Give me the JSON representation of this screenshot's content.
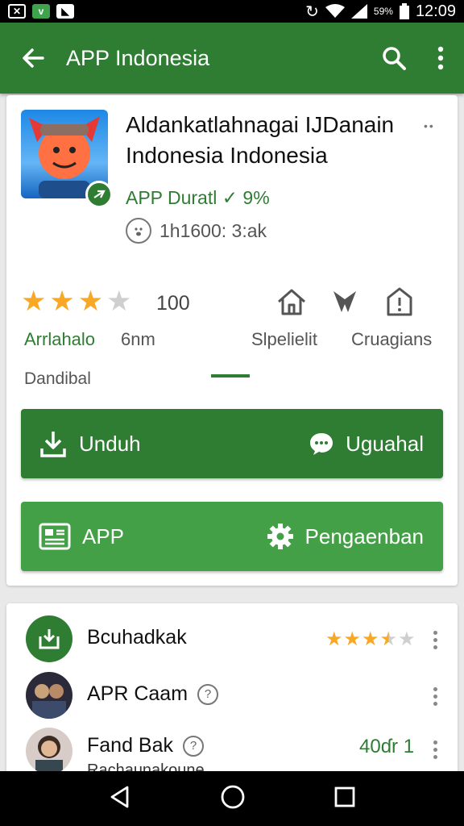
{
  "status_bar": {
    "icons": [
      "x-box-icon",
      "messaging-icon",
      "notification-icon"
    ],
    "battery_text": "59%",
    "time": "12:09"
  },
  "app_bar": {
    "title": "APP Indonesia"
  },
  "app": {
    "name": "Aldankatlahnagai IJDanain Indonesia Indonesia",
    "developer": "APP Duratl ✓ 9%",
    "size_text": "1h1600: 3:ak",
    "rating_count": "100",
    "rating_stars": 3,
    "rating_label": "Arrlahalo",
    "size_label": "6nm",
    "stat1_label": "Slpelielit",
    "stat2_label": "Cruagians",
    "download_label": "Dandibal"
  },
  "buttons": {
    "install_label": "Unduh",
    "chat_label": "Uguahal",
    "app_label": "APP",
    "settings_label": "Pengaenban"
  },
  "list": [
    {
      "name": "Bcuhadkak",
      "stars": 3.5
    },
    {
      "name": "APR Caam"
    },
    {
      "name": "Fand Bak",
      "value": "40ɗr 1",
      "sub": "Rachaunakoune"
    }
  ],
  "colors": {
    "primary": "#2e7d32",
    "button_light": "#43a047",
    "star": "#f9a825"
  }
}
